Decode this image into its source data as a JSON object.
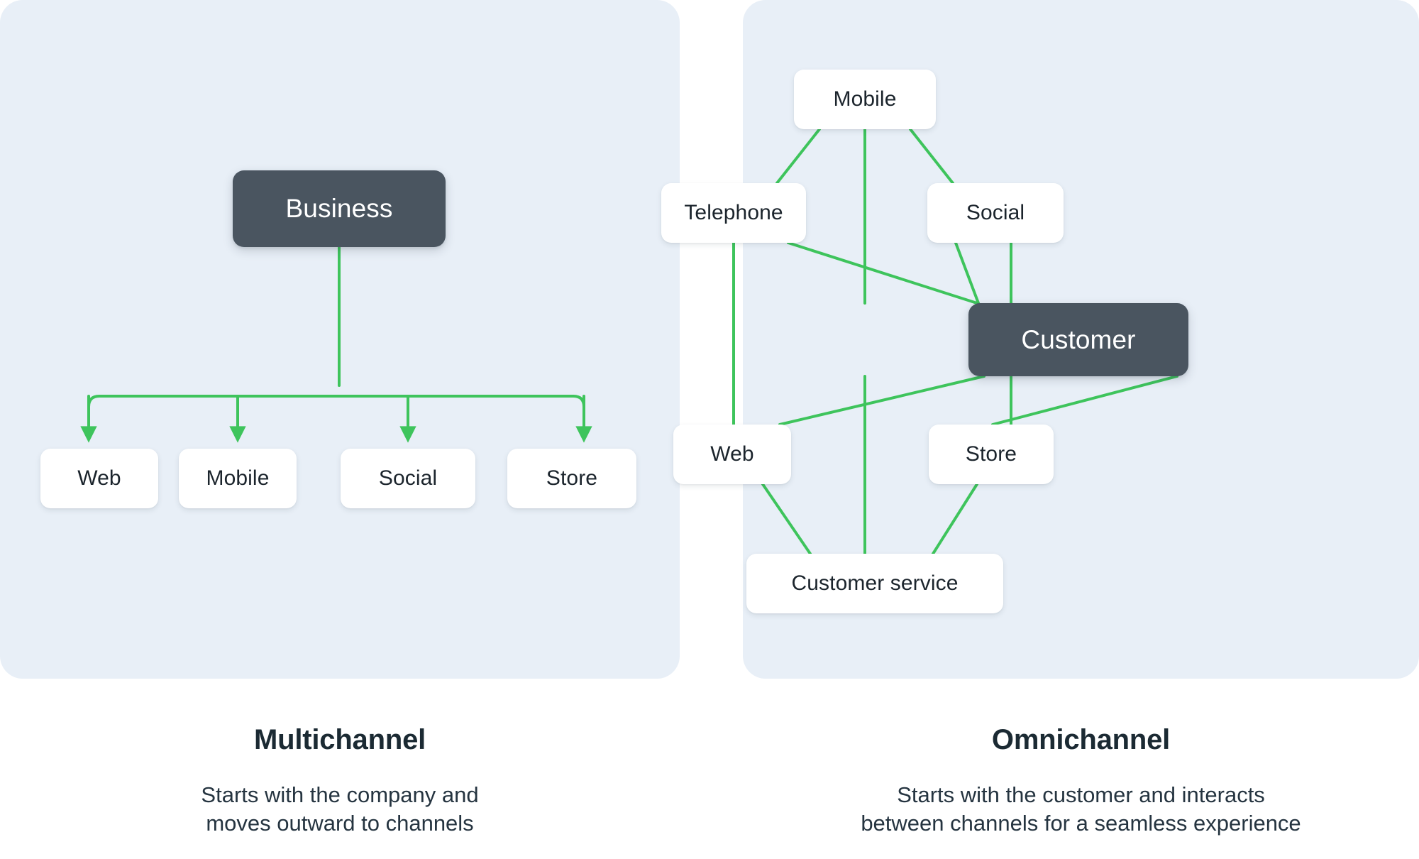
{
  "colors": {
    "panel_background": "#e8eff7",
    "page_background": "#ffffff",
    "connector_green": "#3ec45c",
    "primary_node": "#4a5560",
    "node_background": "#ffffff",
    "title_text": "#1b2a33",
    "body_text": "#253440"
  },
  "panels": [
    {
      "id": "multichannel",
      "diagram_type": "hierarchy-tree",
      "root": {
        "label": "Business",
        "style": "primary"
      },
      "children": [
        {
          "label": "Web"
        },
        {
          "label": "Mobile"
        },
        {
          "label": "Social"
        },
        {
          "label": "Store"
        }
      ],
      "connector_style": "orthogonal-with-arrowheads",
      "caption": {
        "title": "Multichannel",
        "description_line_1": "Starts with the company and",
        "description_line_2": "moves outward to channels"
      }
    },
    {
      "id": "omnichannel",
      "diagram_type": "hub-and-ring",
      "center": {
        "label": "Customer",
        "style": "primary"
      },
      "ring": [
        {
          "label": "Mobile",
          "position": "top"
        },
        {
          "label": "Telephone",
          "position": "upper-left"
        },
        {
          "label": "Social",
          "position": "upper-right"
        },
        {
          "label": "Web",
          "position": "lower-left"
        },
        {
          "label": "Store",
          "position": "lower-right"
        },
        {
          "label": "Customer service",
          "position": "bottom"
        }
      ],
      "connector_style": "straight-lines-no-arrowheads",
      "caption": {
        "title": "Omnichannel",
        "description_line_1": "Starts with the customer and interacts",
        "description_line_2": "between channels for a seamless experience"
      }
    }
  ],
  "chart_data": {
    "type": "diagram",
    "title": "Multichannel vs Omnichannel",
    "diagrams": [
      {
        "name": "Multichannel",
        "nodes": [
          "Business",
          "Web",
          "Mobile",
          "Social",
          "Store"
        ],
        "edges": [
          {
            "from": "Business",
            "to": "Web",
            "directed": true
          },
          {
            "from": "Business",
            "to": "Mobile",
            "directed": true
          },
          {
            "from": "Business",
            "to": "Social",
            "directed": true
          },
          {
            "from": "Business",
            "to": "Store",
            "directed": true
          }
        ]
      },
      {
        "name": "Omnichannel",
        "nodes": [
          "Customer",
          "Mobile",
          "Telephone",
          "Social",
          "Web",
          "Store",
          "Customer service"
        ],
        "edges": [
          {
            "from": "Customer",
            "to": "Mobile",
            "directed": false
          },
          {
            "from": "Customer",
            "to": "Telephone",
            "directed": false
          },
          {
            "from": "Customer",
            "to": "Social",
            "directed": false
          },
          {
            "from": "Customer",
            "to": "Web",
            "directed": false
          },
          {
            "from": "Customer",
            "to": "Store",
            "directed": false
          },
          {
            "from": "Customer",
            "to": "Customer service",
            "directed": false
          },
          {
            "from": "Telephone",
            "to": "Mobile",
            "directed": false
          },
          {
            "from": "Mobile",
            "to": "Social",
            "directed": false
          },
          {
            "from": "Telephone",
            "to": "Web",
            "directed": false
          },
          {
            "from": "Social",
            "to": "Store",
            "directed": false
          },
          {
            "from": "Web",
            "to": "Customer service",
            "directed": false
          },
          {
            "from": "Store",
            "to": "Customer service",
            "directed": false
          }
        ]
      }
    ]
  }
}
